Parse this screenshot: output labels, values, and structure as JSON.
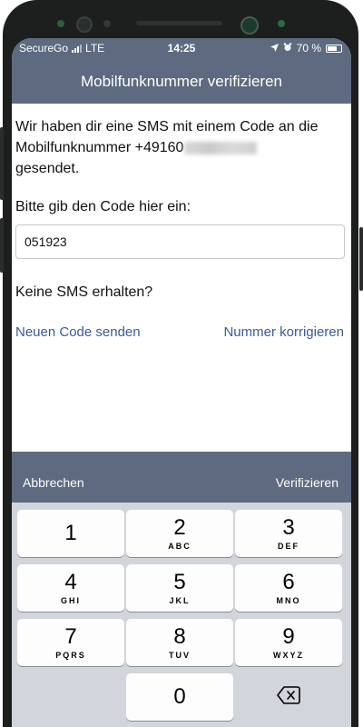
{
  "status_bar": {
    "carrier": "SecureGo",
    "network": "LTE",
    "time": "14:25",
    "battery": "70 %",
    "battery_level": 0.7
  },
  "header": {
    "title": "Mobilfunknummer verifizieren"
  },
  "message": {
    "text_before": "Wir haben dir eine SMS mit einem Code an die Mobilfunknummer +49160",
    "text_after": "gesendet."
  },
  "code": {
    "label": "Bitte gib den Code hier ein:",
    "value": "051923"
  },
  "no_sms": "Keine SMS erhalten?",
  "links": {
    "resend": "Neuen Code senden",
    "correct": "Nummer korrigieren"
  },
  "keyboard_bar": {
    "cancel": "Abbrechen",
    "verify": "Verifizieren"
  },
  "keypad": {
    "keys": [
      {
        "num": "1",
        "letters": ""
      },
      {
        "num": "2",
        "letters": "ABC"
      },
      {
        "num": "3",
        "letters": "DEF"
      },
      {
        "num": "4",
        "letters": "GHI"
      },
      {
        "num": "5",
        "letters": "JKL"
      },
      {
        "num": "6",
        "letters": "MNO"
      },
      {
        "num": "7",
        "letters": "PQRS"
      },
      {
        "num": "8",
        "letters": "TUV"
      },
      {
        "num": "9",
        "letters": "WXYZ"
      },
      {
        "num": "0",
        "letters": ""
      }
    ]
  },
  "colors": {
    "header": "#5e6a7f",
    "link": "#3b5998",
    "keypad_bg": "#d2d5db"
  }
}
